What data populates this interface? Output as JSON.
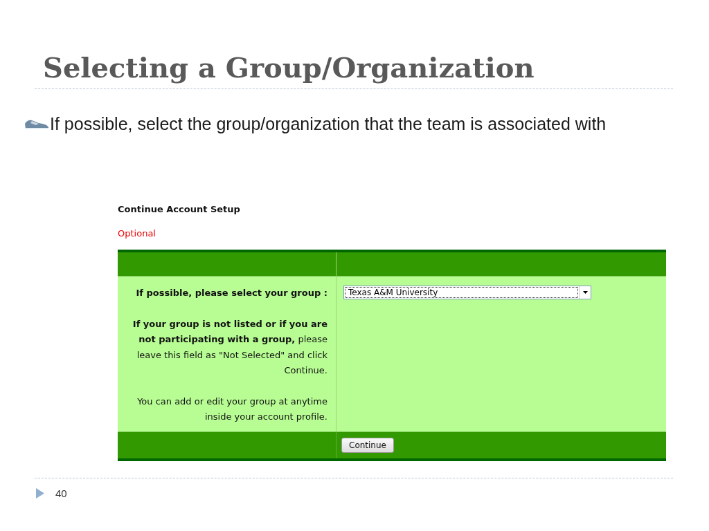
{
  "slide": {
    "title": "Selecting a Group/Organization",
    "bullet": "If possible, select the group/organization that the team is associated with",
    "page_number": "40"
  },
  "form": {
    "heading": "Continue Account Setup",
    "note": "Optional",
    "field_label": "If possible, please select your group :",
    "help_text": "**If your group is not listed or if you are not participating with a group,** please leave this field as \"Not Selected\" and click Continue.",
    "help_text_2": "You can add or edit your group at anytime inside your account profile.",
    "group_select": {
      "value": "Texas A&M University"
    },
    "button": "Continue"
  }
}
